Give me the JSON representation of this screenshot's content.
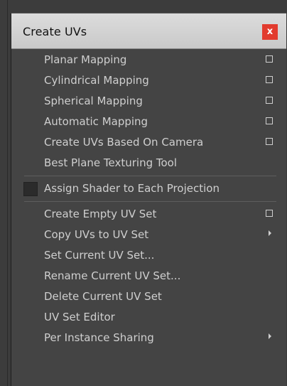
{
  "title": "Create UVs",
  "close_label": "x",
  "groups": [
    [
      {
        "label": "Planar Mapping",
        "has_option_box": true
      },
      {
        "label": "Cylindrical Mapping",
        "has_option_box": true
      },
      {
        "label": "Spherical Mapping",
        "has_option_box": true
      },
      {
        "label": "Automatic Mapping",
        "has_option_box": true
      },
      {
        "label": "Create UVs Based On Camera",
        "has_option_box": true
      },
      {
        "label": "Best Plane Texturing Tool",
        "has_option_box": false
      }
    ],
    [
      {
        "label": "Assign Shader to Each Projection",
        "checkbox": true,
        "checked": false
      }
    ],
    [
      {
        "label": "Create Empty UV Set",
        "has_option_box": true
      },
      {
        "label": "Copy UVs to UV Set",
        "has_submenu": true
      },
      {
        "label": "Set Current UV Set..."
      },
      {
        "label": "Rename Current UV Set..."
      },
      {
        "label": "Delete Current UV Set"
      },
      {
        "label": "UV Set Editor"
      },
      {
        "label": "Per Instance Sharing",
        "has_submenu": true
      }
    ]
  ],
  "colors": {
    "menu_bg": "#444444",
    "text": "#cfcfcf",
    "titlebar": "#d4d4d4",
    "close_bg": "#e23b2e"
  }
}
